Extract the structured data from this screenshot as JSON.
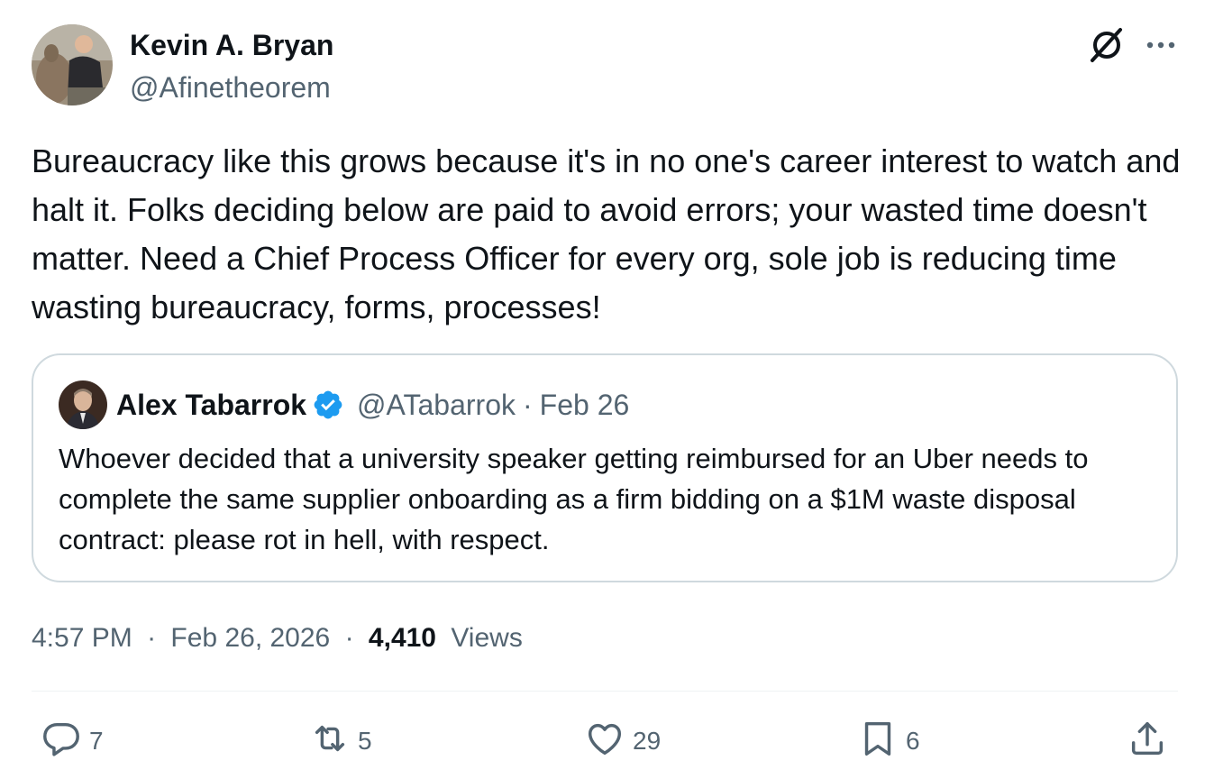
{
  "author": {
    "name": "Kevin A. Bryan",
    "handle": "@Afinetheorem"
  },
  "tweet": {
    "text": "Bureaucracy like this grows because it's in no one's career interest to watch and halt it. Folks deciding below are paid to avoid errors; your wasted time doesn't matter. Need a Chief Process Officer for every org, sole job is reducing time wasting bureaucracy, forms, processes!"
  },
  "quote": {
    "name": "Alex Tabarrok",
    "handle": "@ATabarrok",
    "separator": "·",
    "date": "Feb 26",
    "text": "Whoever decided that a university speaker getting reimbursed for an Uber needs to complete the same supplier onboarding as a firm bidding on a $1M waste disposal contract: please rot in hell, with respect."
  },
  "meta": {
    "time": "4:57 PM",
    "separator": "·",
    "date": "Feb 26, 2026",
    "views_count": "4,410",
    "views_label": "Views"
  },
  "actions": {
    "replies": "7",
    "retweets": "5",
    "likes": "29",
    "bookmarks": "6"
  },
  "colors": {
    "text": "#0f1419",
    "secondary": "#536471",
    "border": "#cfd9de",
    "verified": "#1d9bf0"
  },
  "icons": [
    "grok-icon",
    "more-icon",
    "verified-icon",
    "reply-icon",
    "retweet-icon",
    "like-icon",
    "bookmark-icon",
    "share-icon"
  ]
}
